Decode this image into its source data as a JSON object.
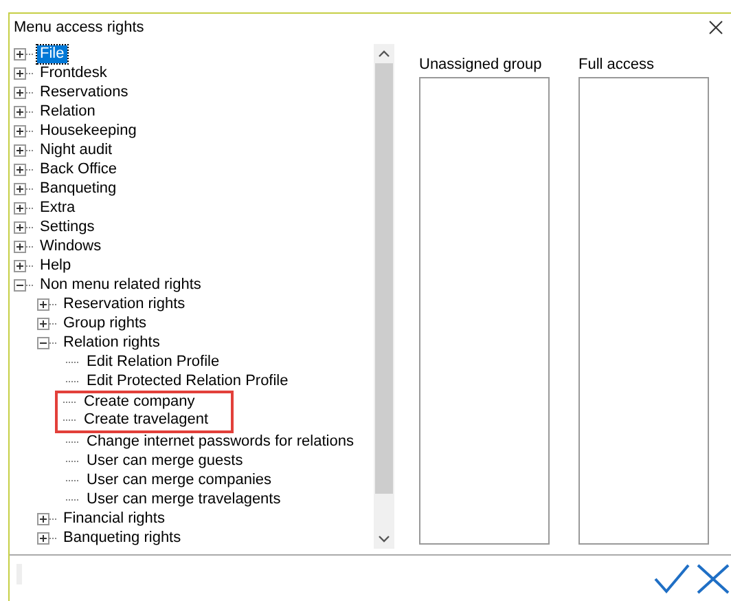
{
  "window": {
    "title": "Menu access rights"
  },
  "tree": [
    {
      "label": "File",
      "expanded": false,
      "selected": true
    },
    {
      "label": "Frontdesk",
      "expanded": false,
      "selected": false
    },
    {
      "label": "Reservations",
      "expanded": false,
      "selected": false
    },
    {
      "label": "Relation",
      "expanded": false,
      "selected": false
    },
    {
      "label": "Housekeeping",
      "expanded": false,
      "selected": false
    },
    {
      "label": "Night audit",
      "expanded": false,
      "selected": false
    },
    {
      "label": "Back Office",
      "expanded": false,
      "selected": false
    },
    {
      "label": "Banqueting",
      "expanded": false,
      "selected": false
    },
    {
      "label": "Extra",
      "expanded": false,
      "selected": false
    },
    {
      "label": "Settings",
      "expanded": false,
      "selected": false
    },
    {
      "label": "Windows",
      "expanded": false,
      "selected": false
    },
    {
      "label": "Help",
      "expanded": false,
      "selected": false
    },
    {
      "label": "Non menu related rights",
      "expanded": true,
      "selected": false,
      "children": [
        {
          "label": "Reservation rights",
          "expanded": false,
          "selected": false
        },
        {
          "label": "Group rights",
          "expanded": false,
          "selected": false
        },
        {
          "label": "Relation rights",
          "expanded": true,
          "selected": false,
          "children": [
            {
              "label": "Edit Relation Profile",
              "selected": false,
              "highlighted": false
            },
            {
              "label": "Edit Protected Relation Profile",
              "selected": false,
              "highlighted": false
            },
            {
              "label": "Create company",
              "selected": false,
              "highlighted": true
            },
            {
              "label": "Create travelagent",
              "selected": false,
              "highlighted": true
            },
            {
              "label": "Change internet passwords for relations",
              "selected": false,
              "highlighted": false
            },
            {
              "label": "User can merge guests",
              "selected": false,
              "highlighted": false
            },
            {
              "label": "User can merge companies",
              "selected": false,
              "highlighted": false
            },
            {
              "label": "User can merge travelagents",
              "selected": false,
              "highlighted": false
            }
          ]
        },
        {
          "label": "Financial rights",
          "expanded": false,
          "selected": false
        },
        {
          "label": "Banqueting rights",
          "expanded": false,
          "selected": false
        }
      ]
    }
  ],
  "lists": [
    {
      "label": "Unassigned group"
    },
    {
      "label": "Full access"
    }
  ],
  "buttons": [
    {
      "kind": "ok"
    },
    {
      "kind": "cancel"
    }
  ]
}
